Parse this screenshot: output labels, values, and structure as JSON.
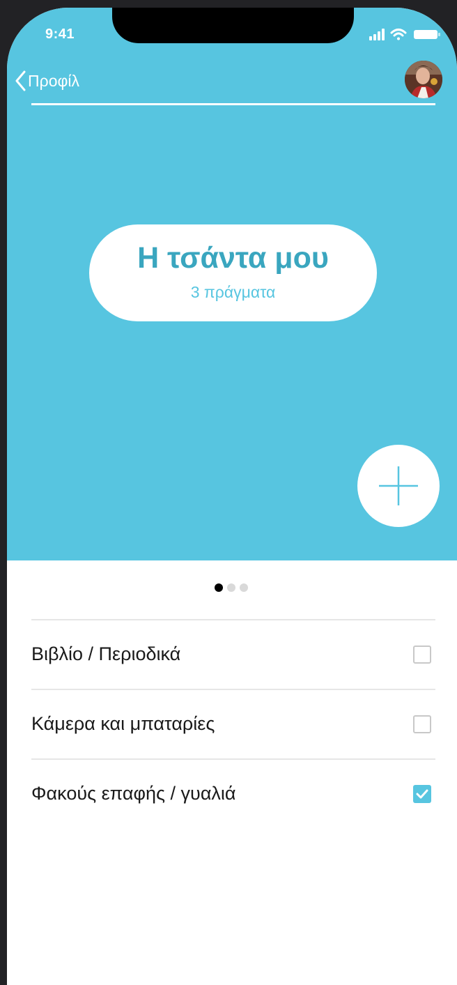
{
  "status_bar": {
    "time": "9:41",
    "icons": [
      "signal-icon",
      "wifi-icon",
      "battery-icon"
    ]
  },
  "nav": {
    "back_label": "Προφίλ",
    "avatar": "user-avatar"
  },
  "bag": {
    "title": "Η τσάντα μου",
    "count_label": "3 πράγματα"
  },
  "add_button": {
    "icon": "plus-icon"
  },
  "pager": {
    "total": 3,
    "active_index": 0
  },
  "checklist": {
    "items": [
      {
        "label": "Βιβλίο / Περιοδικά",
        "checked": false
      },
      {
        "label": "Κάμερα και μπαταρίες",
        "checked": false
      },
      {
        "label": "Φακούς επαφής / γυαλιά",
        "checked": true
      }
    ]
  },
  "colors": {
    "accent": "#57c5e0",
    "title_text": "#3aa6bf",
    "device_frame": "#222225"
  }
}
